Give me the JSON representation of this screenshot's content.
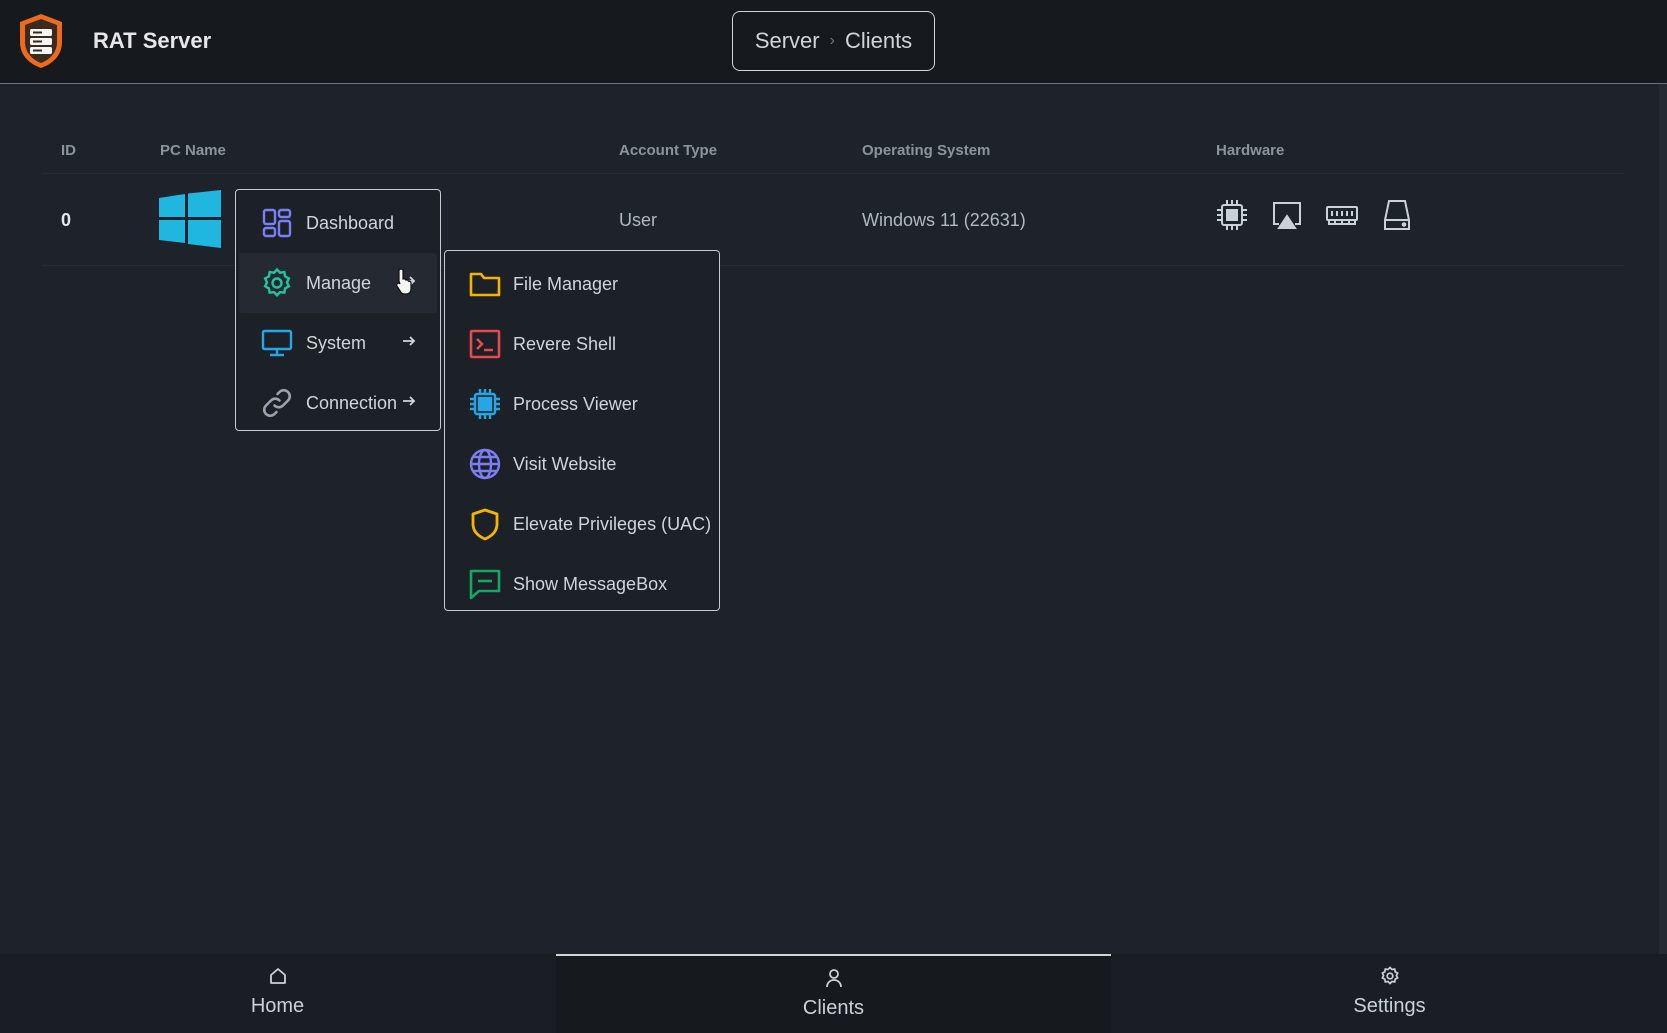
{
  "app": {
    "title": "RAT Server"
  },
  "breadcrumb": {
    "items": [
      "Server",
      "Clients"
    ],
    "separator": "›"
  },
  "table": {
    "headers": {
      "id": "ID",
      "pc_name": "PC Name",
      "account_type": "Account Type",
      "os": "Operating System",
      "hardware": "Hardware"
    },
    "rows": [
      {
        "id": "0",
        "pc_name_icon": "windows-logo-icon",
        "account_type": "User",
        "os": "Windows 11 (22631)",
        "hardware_icons": [
          "cpu-icon",
          "display-icon",
          "ram-icon",
          "disk-icon"
        ]
      }
    ]
  },
  "context_menu": {
    "items": [
      {
        "label": "Dashboard",
        "icon": "dashboard-icon",
        "color": "#7b7ff5",
        "has_submenu": false
      },
      {
        "label": "Manage",
        "icon": "gear-icon",
        "color": "#21c5a0",
        "has_submenu": true,
        "hovered": true
      },
      {
        "label": "System",
        "icon": "monitor-icon",
        "color": "#27a6e6",
        "has_submenu": true
      },
      {
        "label": "Connection",
        "icon": "link-icon",
        "color": "#9ca3af",
        "has_submenu": true
      }
    ]
  },
  "submenu": {
    "parent": "Manage",
    "items": [
      {
        "label": "File Manager",
        "icon": "folder-icon",
        "color": "#f5b400"
      },
      {
        "label": "Revere Shell",
        "icon": "terminal-icon",
        "color": "#e5484d"
      },
      {
        "label": "Process Viewer",
        "icon": "chip-icon",
        "color": "#27a6e6"
      },
      {
        "label": "Visit Website",
        "icon": "globe-icon",
        "color": "#7b7ff5"
      },
      {
        "label": "Elevate Privileges (UAC)",
        "icon": "shield-icon",
        "color": "#f5b400"
      },
      {
        "label": "Show MessageBox",
        "icon": "message-icon",
        "color": "#16a765"
      }
    ]
  },
  "bottom_nav": {
    "items": [
      {
        "label": "Home",
        "icon": "home-icon",
        "active": false
      },
      {
        "label": "Clients",
        "icon": "user-icon",
        "active": true
      },
      {
        "label": "Settings",
        "icon": "gear-icon",
        "active": false
      }
    ]
  },
  "colors": {
    "background": "#1e232b",
    "titlebar": "#16191e",
    "windows_logo": "#1fb6e0",
    "logo_orange": "#ee6a1c"
  }
}
